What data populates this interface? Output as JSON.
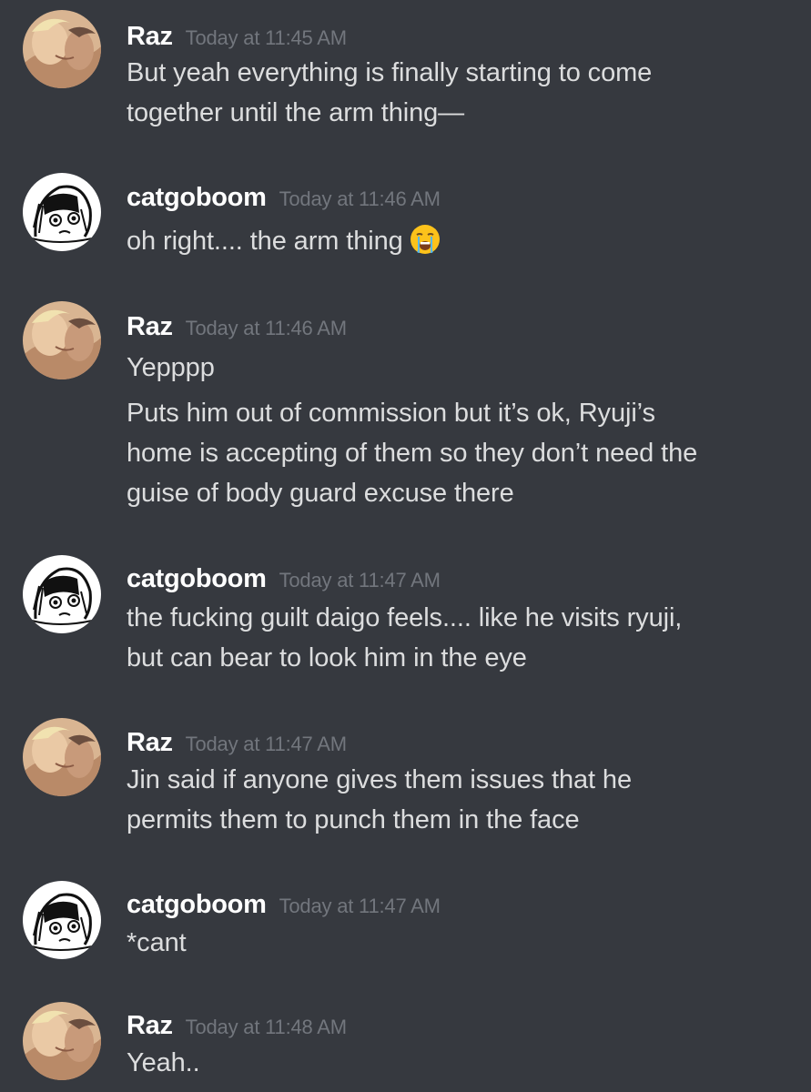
{
  "messages": [
    {
      "author": "Raz",
      "timestamp": "Today at 11:45 AM",
      "avatar_icon": "raz-avatar",
      "lines": [
        "But yeah everything is finally starting to come",
        "together until the arm thing—"
      ]
    },
    {
      "author": "catgoboom",
      "timestamp": "Today at 11:46 AM",
      "avatar_icon": "catgoboom-avatar",
      "lines": [
        "oh right.... the arm thing"
      ],
      "emoji": "loudly-crying-face-emoji"
    },
    {
      "author": "Raz",
      "timestamp": "Today at 11:46 AM",
      "avatar_icon": "raz-avatar",
      "lines": [
        "Yepppp"
      ],
      "followup_lines": [
        "Puts him out of  commission but it’s ok, Ryuji’s",
        "home is accepting of them so they don’t need the",
        "guise of body guard excuse there"
      ]
    },
    {
      "author": "catgoboom",
      "timestamp": "Today at 11:47 AM",
      "avatar_icon": "catgoboom-avatar",
      "lines": [
        "the fucking guilt daigo feels.... like he visits ryuji,",
        "but can bear to look him in the eye"
      ]
    },
    {
      "author": "Raz",
      "timestamp": "Today at 11:47 AM",
      "avatar_icon": "raz-avatar",
      "lines": [
        "Jin said if anyone gives them issues that he",
        "permits them to punch them in the face"
      ]
    },
    {
      "author": "catgoboom",
      "timestamp": "Today at 11:47 AM",
      "avatar_icon": "catgoboom-avatar",
      "lines": [
        "*cant"
      ]
    },
    {
      "author": "Raz",
      "timestamp": "Today at 11:48 AM",
      "avatar_icon": "raz-avatar",
      "lines": [
        "Yeah.."
      ]
    }
  ],
  "colors": {
    "background": "#36393f",
    "username": "#ffffff",
    "timestamp": "#72767d",
    "text": "#dcddde"
  }
}
